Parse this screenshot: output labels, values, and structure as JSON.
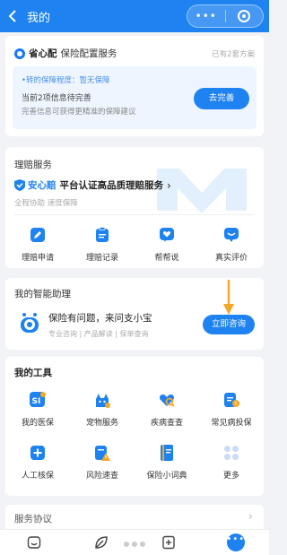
{
  "header": {
    "title": "我的",
    "more": "•••"
  },
  "card1": {
    "brand": "省心配",
    "subtitle": "保险配置服务",
    "right": "已有2套方案",
    "line1": "•转的保障程度：暂无保障",
    "line2": "当前2项信息待完善",
    "line3": "完善信息可获得更精准的保障建议",
    "button": "去完善"
  },
  "claims": {
    "title": "理赔服务",
    "brand": "安心赔",
    "desc": "平台认证高品质理赔服务",
    "chevron": "›",
    "sub": "全程协助 速度保障",
    "items": [
      {
        "label": "理赔申请",
        "icon": "edit-icon"
      },
      {
        "label": "理赔记录",
        "icon": "clipboard-icon"
      },
      {
        "label": "帮帮说",
        "icon": "heart-chat-icon"
      },
      {
        "label": "真实评价",
        "icon": "comment-icon"
      }
    ]
  },
  "assistant": {
    "title": "我的智能助理",
    "text": "保险有问题，来问支小宝",
    "tags": "专业咨询 | 产品解读 | 保单查询",
    "button": "立即咨询"
  },
  "tools": {
    "title": "我的工具",
    "items": [
      {
        "label": "我的医保",
        "icon": "medical-insurance-icon"
      },
      {
        "label": "宠物服务",
        "icon": "pet-icon"
      },
      {
        "label": "疾病查查",
        "icon": "disease-search-icon"
      },
      {
        "label": "常见病投保",
        "icon": "common-illness-icon"
      },
      {
        "label": "人工核保",
        "icon": "underwriting-icon"
      },
      {
        "label": "风险速查",
        "icon": "risk-icon"
      },
      {
        "label": "保险小词典",
        "icon": "dictionary-icon"
      },
      {
        "label": "更多",
        "icon": "more-grid-icon"
      }
    ]
  },
  "agreement": {
    "title": "服务协议",
    "chevron": "›"
  },
  "tabbar": {
    "active_label": "•••"
  },
  "colors": {
    "primary": "#1e82f0",
    "accent_orange": "#f5a623"
  }
}
